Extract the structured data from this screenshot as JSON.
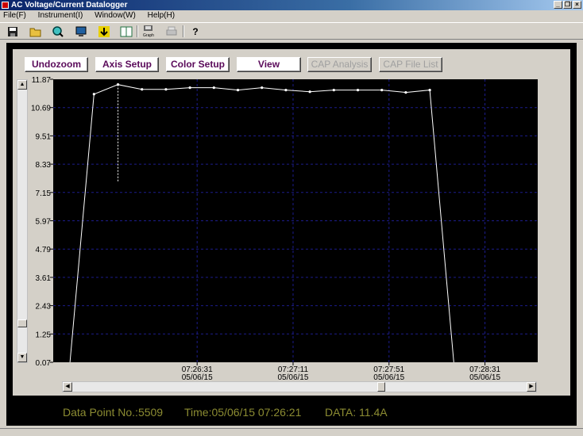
{
  "window": {
    "title": "AC Voltage/Current Datalogger"
  },
  "menu": [
    "File(F)",
    "Instrument(I)",
    "Window(W)",
    "Help(H)"
  ],
  "toolbar": {
    "graph_label": "Graph"
  },
  "buttons": {
    "undozoom": "Undozoom",
    "axis_setup": "Axis Setup",
    "color_setup": "Color Setup",
    "view": "View",
    "cap_analysis": "CAP Analysis",
    "cap_file_list": "CAP File List"
  },
  "status": {
    "data_point": "Data Point No.:5509",
    "time": "Time:05/06/15 07:26:21",
    "data": "DATA: 11.4A"
  },
  "colors": {
    "plot_bg": "#000000",
    "grid": "#1c1c8c",
    "line": "#ffffff",
    "status_text": "#8c8c32"
  },
  "chart_data": {
    "type": "line",
    "ylim": [
      0.07,
      11.87
    ],
    "yticks": [
      "11.87",
      "10.69",
      "9.51",
      "8.33",
      "7.15",
      "5.97",
      "4.79",
      "3.61",
      "2.43",
      "1.25",
      "0.07"
    ],
    "xlim": [
      "07:25:31",
      "07:28:53"
    ],
    "xticks": [
      {
        "time": "07:26:31",
        "date": "05/06/15",
        "t": 60
      },
      {
        "time": "07:27:11",
        "date": "05/06/15",
        "t": 100
      },
      {
        "time": "07:27:51",
        "date": "05/06/15",
        "t": 140
      },
      {
        "time": "07:28:31",
        "date": "05/06/15",
        "t": 180
      }
    ],
    "series": [
      {
        "points": [
          {
            "t": 7,
            "v": 0.07
          },
          {
            "t": 17,
            "v": 11.25,
            "m": true
          },
          {
            "t": 27,
            "v": 11.65,
            "m": true
          },
          {
            "t": 37,
            "v": 11.45,
            "m": true
          },
          {
            "t": 47,
            "v": 11.45,
            "m": true
          },
          {
            "t": 57,
            "v": 11.52,
            "m": true
          },
          {
            "t": 67,
            "v": 11.52,
            "m": true
          },
          {
            "t": 77,
            "v": 11.42,
            "m": true
          },
          {
            "t": 87,
            "v": 11.52,
            "m": true
          },
          {
            "t": 97,
            "v": 11.42,
            "m": true
          },
          {
            "t": 107,
            "v": 11.35,
            "m": true
          },
          {
            "t": 117,
            "v": 11.42,
            "m": true
          },
          {
            "t": 127,
            "v": 11.42,
            "m": true
          },
          {
            "t": 137,
            "v": 11.42,
            "m": true
          },
          {
            "t": 147,
            "v": 11.32,
            "m": true
          },
          {
            "t": 157,
            "v": 11.42,
            "m": true
          },
          {
            "t": 167,
            "v": 0.07
          }
        ]
      }
    ],
    "cursor": {
      "t": 27,
      "v_from": 7.6,
      "v_to": 11.65
    }
  }
}
